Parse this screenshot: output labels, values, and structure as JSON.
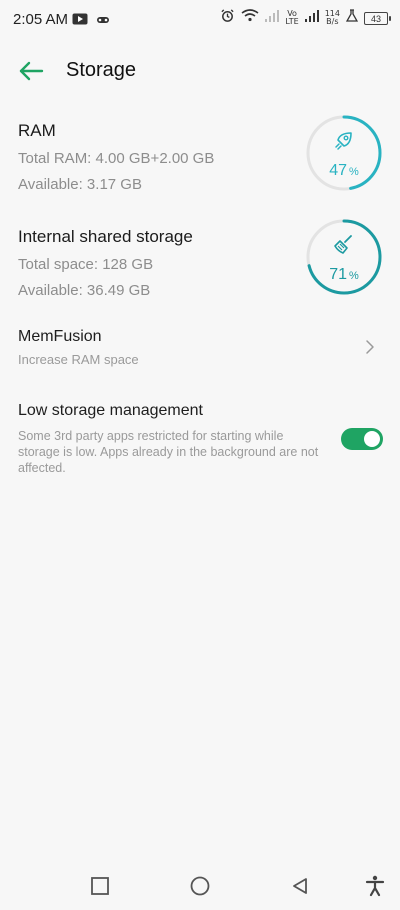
{
  "status_bar": {
    "time": "2:05 AM",
    "left_icons": [
      "youtube-icon",
      "game-controller-icon"
    ],
    "network_label_top": "Vo",
    "network_label_bottom": "LTE",
    "speed_value": "114",
    "speed_unit": "B/s",
    "battery": "43",
    "right_icons": [
      "alarm-icon",
      "wifi-icon",
      "signal-icon",
      "signal-icon",
      "flask-icon",
      "battery-icon"
    ]
  },
  "header": {
    "title": "Storage",
    "back_icon": "back-arrow-icon"
  },
  "ram": {
    "title": "RAM",
    "total": "Total RAM: 4.00 GB+2.00 GB",
    "available": "Available: 3.17 GB",
    "usage_value": "47",
    "usage_unit": "%",
    "usage_fraction": 0.47,
    "icon": "rocket-icon",
    "color": "#29b3c2"
  },
  "storage": {
    "title": "Internal shared storage",
    "total": "Total space: 128 GB",
    "available": "Available: 36.49 GB",
    "usage_value": "71",
    "usage_unit": "%",
    "usage_fraction": 0.71,
    "icon": "broom-icon",
    "color": "#1c9aa1"
  },
  "memfusion": {
    "title": "MemFusion",
    "subtitle": "Increase RAM space"
  },
  "low_storage": {
    "title": "Low storage management",
    "description": "Some 3rd party apps restricted for starting while storage is low. Apps already in the background are not affected.",
    "enabled": true,
    "accent_color": "#1fa463"
  },
  "navigation": {
    "buttons": [
      "recent-apps-icon",
      "home-icon",
      "back-triangle-icon",
      "accessibility-icon"
    ]
  }
}
